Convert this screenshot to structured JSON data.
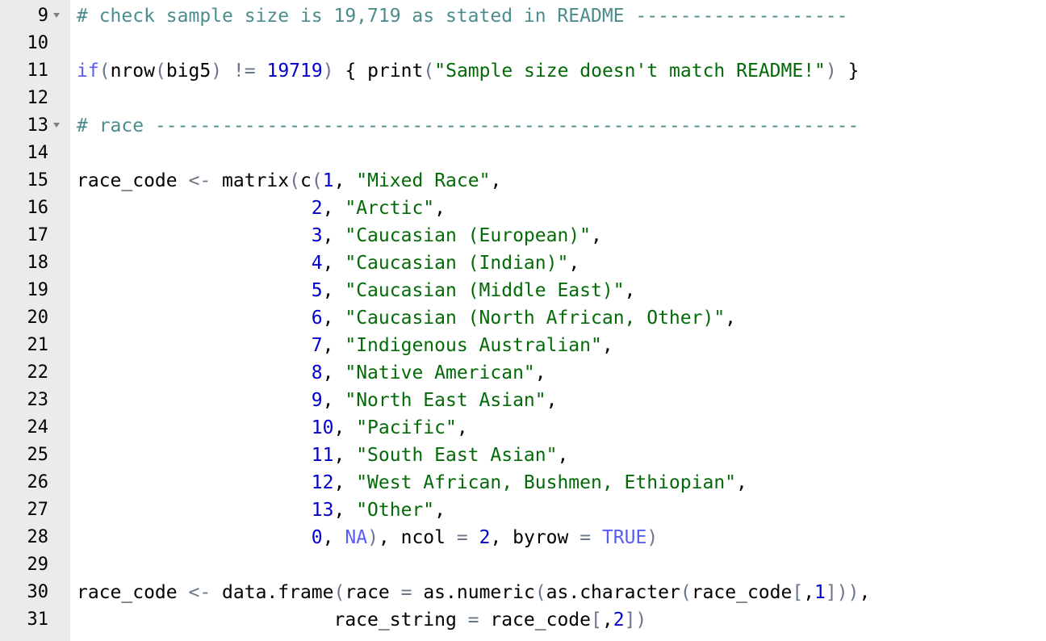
{
  "editor": {
    "fold_lines": [
      9,
      13
    ],
    "colors": {
      "gutter": "#ebebeb",
      "comment": "#4b8d8d",
      "string": "#036a07",
      "number": "#0000cd",
      "constant": "#585cf6",
      "operator": "#687687",
      "text": "#000000"
    },
    "lines": [
      {
        "n": "9",
        "fold": true,
        "tokens": [
          {
            "t": "# check sample size is 19,719 as stated in README -------------------",
            "k": "comment"
          }
        ]
      },
      {
        "n": "10",
        "fold": false,
        "tokens": []
      },
      {
        "n": "11",
        "fold": false,
        "tokens": [
          {
            "t": "if",
            "k": "const"
          },
          {
            "t": "(",
            "k": "op"
          },
          {
            "t": "nrow",
            "k": "fn"
          },
          {
            "t": "(",
            "k": "op"
          },
          {
            "t": "big5",
            "k": "text"
          },
          {
            "t": ")",
            "k": "op"
          },
          {
            "t": " ",
            "k": "text"
          },
          {
            "t": "!=",
            "k": "op"
          },
          {
            "t": " ",
            "k": "text"
          },
          {
            "t": "19719",
            "k": "number"
          },
          {
            "t": ")",
            "k": "op"
          },
          {
            "t": " { ",
            "k": "text"
          },
          {
            "t": "print",
            "k": "fn"
          },
          {
            "t": "(",
            "k": "op"
          },
          {
            "t": "\"Sample size doesn't match README!\"",
            "k": "string"
          },
          {
            "t": ")",
            "k": "op"
          },
          {
            "t": " }",
            "k": "text"
          }
        ]
      },
      {
        "n": "12",
        "fold": false,
        "tokens": []
      },
      {
        "n": "13",
        "fold": true,
        "tokens": [
          {
            "t": "# race ---------------------------------------------------------------",
            "k": "comment"
          }
        ]
      },
      {
        "n": "14",
        "fold": false,
        "tokens": []
      },
      {
        "n": "15",
        "fold": false,
        "tokens": [
          {
            "t": "race_code ",
            "k": "text"
          },
          {
            "t": "<-",
            "k": "op"
          },
          {
            "t": " matrix",
            "k": "fn"
          },
          {
            "t": "(",
            "k": "op"
          },
          {
            "t": "c",
            "k": "fn"
          },
          {
            "t": "(",
            "k": "op"
          },
          {
            "t": "1",
            "k": "number"
          },
          {
            "t": ", ",
            "k": "text"
          },
          {
            "t": "\"Mixed Race\"",
            "k": "string"
          },
          {
            "t": ",",
            "k": "text"
          }
        ]
      },
      {
        "n": "16",
        "fold": false,
        "tokens": [
          {
            "t": "                     ",
            "k": "text"
          },
          {
            "t": "2",
            "k": "number"
          },
          {
            "t": ", ",
            "k": "text"
          },
          {
            "t": "\"Arctic\"",
            "k": "string"
          },
          {
            "t": ",",
            "k": "text"
          }
        ]
      },
      {
        "n": "17",
        "fold": false,
        "tokens": [
          {
            "t": "                     ",
            "k": "text"
          },
          {
            "t": "3",
            "k": "number"
          },
          {
            "t": ", ",
            "k": "text"
          },
          {
            "t": "\"Caucasian (European)\"",
            "k": "string"
          },
          {
            "t": ",",
            "k": "text"
          }
        ]
      },
      {
        "n": "18",
        "fold": false,
        "tokens": [
          {
            "t": "                     ",
            "k": "text"
          },
          {
            "t": "4",
            "k": "number"
          },
          {
            "t": ", ",
            "k": "text"
          },
          {
            "t": "\"Caucasian (Indian)\"",
            "k": "string"
          },
          {
            "t": ",",
            "k": "text"
          }
        ]
      },
      {
        "n": "19",
        "fold": false,
        "tokens": [
          {
            "t": "                     ",
            "k": "text"
          },
          {
            "t": "5",
            "k": "number"
          },
          {
            "t": ", ",
            "k": "text"
          },
          {
            "t": "\"Caucasian (Middle East)\"",
            "k": "string"
          },
          {
            "t": ",",
            "k": "text"
          }
        ]
      },
      {
        "n": "20",
        "fold": false,
        "tokens": [
          {
            "t": "                     ",
            "k": "text"
          },
          {
            "t": "6",
            "k": "number"
          },
          {
            "t": ", ",
            "k": "text"
          },
          {
            "t": "\"Caucasian (North African, Other)\"",
            "k": "string"
          },
          {
            "t": ",",
            "k": "text"
          }
        ]
      },
      {
        "n": "21",
        "fold": false,
        "tokens": [
          {
            "t": "                     ",
            "k": "text"
          },
          {
            "t": "7",
            "k": "number"
          },
          {
            "t": ", ",
            "k": "text"
          },
          {
            "t": "\"Indigenous Australian\"",
            "k": "string"
          },
          {
            "t": ",",
            "k": "text"
          }
        ]
      },
      {
        "n": "22",
        "fold": false,
        "tokens": [
          {
            "t": "                     ",
            "k": "text"
          },
          {
            "t": "8",
            "k": "number"
          },
          {
            "t": ", ",
            "k": "text"
          },
          {
            "t": "\"Native American\"",
            "k": "string"
          },
          {
            "t": ",",
            "k": "text"
          }
        ]
      },
      {
        "n": "23",
        "fold": false,
        "tokens": [
          {
            "t": "                     ",
            "k": "text"
          },
          {
            "t": "9",
            "k": "number"
          },
          {
            "t": ", ",
            "k": "text"
          },
          {
            "t": "\"North East Asian\"",
            "k": "string"
          },
          {
            "t": ",",
            "k": "text"
          }
        ]
      },
      {
        "n": "24",
        "fold": false,
        "tokens": [
          {
            "t": "                     ",
            "k": "text"
          },
          {
            "t": "10",
            "k": "number"
          },
          {
            "t": ", ",
            "k": "text"
          },
          {
            "t": "\"Pacific\"",
            "k": "string"
          },
          {
            "t": ",",
            "k": "text"
          }
        ]
      },
      {
        "n": "25",
        "fold": false,
        "tokens": [
          {
            "t": "                     ",
            "k": "text"
          },
          {
            "t": "11",
            "k": "number"
          },
          {
            "t": ", ",
            "k": "text"
          },
          {
            "t": "\"South East Asian\"",
            "k": "string"
          },
          {
            "t": ",",
            "k": "text"
          }
        ]
      },
      {
        "n": "26",
        "fold": false,
        "tokens": [
          {
            "t": "                     ",
            "k": "text"
          },
          {
            "t": "12",
            "k": "number"
          },
          {
            "t": ", ",
            "k": "text"
          },
          {
            "t": "\"West African, Bushmen, Ethiopian\"",
            "k": "string"
          },
          {
            "t": ",",
            "k": "text"
          }
        ]
      },
      {
        "n": "27",
        "fold": false,
        "tokens": [
          {
            "t": "                     ",
            "k": "text"
          },
          {
            "t": "13",
            "k": "number"
          },
          {
            "t": ", ",
            "k": "text"
          },
          {
            "t": "\"Other\"",
            "k": "string"
          },
          {
            "t": ",",
            "k": "text"
          }
        ]
      },
      {
        "n": "28",
        "fold": false,
        "tokens": [
          {
            "t": "                     ",
            "k": "text"
          },
          {
            "t": "0",
            "k": "number"
          },
          {
            "t": ", ",
            "k": "text"
          },
          {
            "t": "NA",
            "k": "const"
          },
          {
            "t": ")",
            "k": "op"
          },
          {
            "t": ", ncol ",
            "k": "text"
          },
          {
            "t": "=",
            "k": "op"
          },
          {
            "t": " ",
            "k": "text"
          },
          {
            "t": "2",
            "k": "number"
          },
          {
            "t": ", byrow ",
            "k": "text"
          },
          {
            "t": "=",
            "k": "op"
          },
          {
            "t": " ",
            "k": "text"
          },
          {
            "t": "TRUE",
            "k": "const"
          },
          {
            "t": ")",
            "k": "op"
          }
        ]
      },
      {
        "n": "29",
        "fold": false,
        "tokens": []
      },
      {
        "n": "30",
        "fold": false,
        "tokens": [
          {
            "t": "race_code ",
            "k": "text"
          },
          {
            "t": "<-",
            "k": "op"
          },
          {
            "t": " data.frame",
            "k": "fn"
          },
          {
            "t": "(",
            "k": "op"
          },
          {
            "t": "race ",
            "k": "text"
          },
          {
            "t": "=",
            "k": "op"
          },
          {
            "t": " as.numeric",
            "k": "fn"
          },
          {
            "t": "(",
            "k": "op"
          },
          {
            "t": "as.character",
            "k": "fn"
          },
          {
            "t": "(",
            "k": "op"
          },
          {
            "t": "race_code",
            "k": "text"
          },
          {
            "t": "[",
            "k": "op"
          },
          {
            "t": ",",
            "k": "text"
          },
          {
            "t": "1",
            "k": "number"
          },
          {
            "t": "]))",
            "k": "op"
          },
          {
            "t": ",",
            "k": "text"
          }
        ]
      },
      {
        "n": "31",
        "fold": false,
        "tokens": [
          {
            "t": "                       race_string ",
            "k": "text"
          },
          {
            "t": "=",
            "k": "op"
          },
          {
            "t": " race_code",
            "k": "text"
          },
          {
            "t": "[",
            "k": "op"
          },
          {
            "t": ",",
            "k": "text"
          },
          {
            "t": "2",
            "k": "number"
          },
          {
            "t": "])",
            "k": "op"
          }
        ]
      }
    ]
  }
}
